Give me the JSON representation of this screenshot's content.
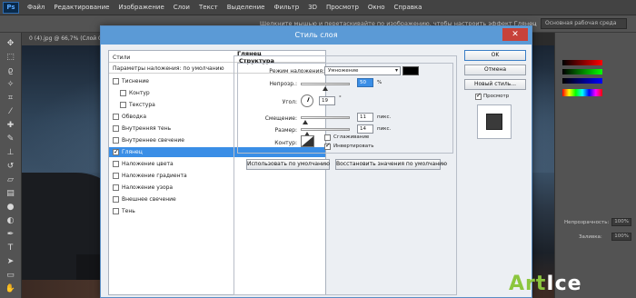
{
  "app": {
    "menu": [
      "Файл",
      "Редактирование",
      "Изображение",
      "Слои",
      "Текст",
      "Выделение",
      "Фильтр",
      "3D",
      "Просмотр",
      "Окно",
      "Справка"
    ],
    "hint": "Щелкните мышью и перетаскивайте по изображению, чтобы настроить эффект Глянец",
    "workspace": "Основная рабочая среда",
    "doc_tab": "0 (4).jpg @ 66,7% (Слой 0...",
    "panel_texts": [
      "Непрозрачность:",
      "100%",
      "Заливка:",
      "100%"
    ]
  },
  "dialog": {
    "title": "Стиль слоя",
    "close": "✕",
    "styles_header": "Стили",
    "blend_options": "Параметры наложения: по умолчанию",
    "styles": [
      {
        "label": "Тиснение",
        "checked": false,
        "indent": false
      },
      {
        "label": "Контур",
        "checked": false,
        "indent": true
      },
      {
        "label": "Текстура",
        "checked": false,
        "indent": true
      },
      {
        "label": "Обводка",
        "checked": false,
        "indent": false
      },
      {
        "label": "Внутренняя тень",
        "checked": false,
        "indent": false
      },
      {
        "label": "Внутреннее свечение",
        "checked": false,
        "indent": false
      },
      {
        "label": "Глянец",
        "checked": true,
        "indent": false,
        "selected": true
      },
      {
        "label": "Наложение цвета",
        "checked": false,
        "indent": false
      },
      {
        "label": "Наложение градиента",
        "checked": false,
        "indent": false
      },
      {
        "label": "Наложение узора",
        "checked": false,
        "indent": false
      },
      {
        "label": "Внешнее свечение",
        "checked": false,
        "indent": false
      },
      {
        "label": "Тень",
        "checked": false,
        "indent": false
      }
    ],
    "section_title": "Глянец",
    "group_title": "Структура",
    "blend_mode_label": "Режим наложения:",
    "blend_mode_value": "Умножение",
    "opacity_label": "Непрозр.:",
    "opacity_value": "50",
    "opacity_unit": "%",
    "angle_label": "Угол:",
    "angle_value": "19",
    "angle_unit": "°",
    "distance_label": "Смещение:",
    "distance_value": "11",
    "distance_unit": "пикс.",
    "size_label": "Размер:",
    "size_value": "14",
    "size_unit": "пикс.",
    "contour_label": "Контур:",
    "antialias_label": "Сглаживание",
    "invert_label": "Инвертировать",
    "invert_checked": true,
    "default_button": "Использовать по умолчанию",
    "restore_button": "Восстановить значения по умолчанию",
    "ok": "OK",
    "cancel": "Отмена",
    "new_style": "Новый стиль...",
    "preview_label": "Просмотр",
    "preview_checked": true,
    "accent_color": "#5b9ad6",
    "selection_color": "#3a8ee6"
  },
  "watermark": {
    "part1": "Art",
    "part2": "Ice"
  }
}
